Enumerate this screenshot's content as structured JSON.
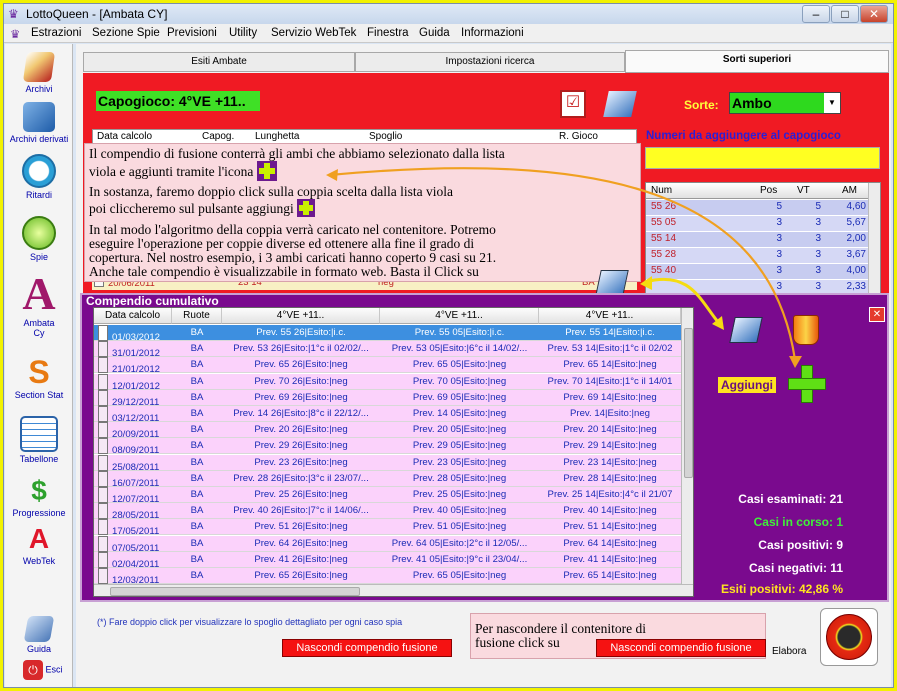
{
  "window": {
    "title": "LottoQueen - [Ambata CY]"
  },
  "menu": [
    "Estrazioni",
    "Sezione Spie",
    "Previsioni",
    "Utility",
    "Servizio WebTek",
    "Finestra",
    "Guida",
    "Informazioni"
  ],
  "sidebar": [
    "Archivi",
    "Archivi derivati",
    "Ritardi",
    "Spie",
    "Ambata Cy",
    "Section Stat",
    "Tabellone",
    "Progressione",
    "WebTek",
    "Guida",
    "Esci"
  ],
  "tabs": [
    "Esiti Ambate",
    "Impostazioni ricerca",
    "Sorti superiori"
  ],
  "top": {
    "capogioco": "Capogioco: 4°VE +11..",
    "sorte_label": "Sorte:",
    "sorte_value": "Ambo",
    "numeri_label": "Numeri da aggiungere al capogioco",
    "headers": [
      "Data calcolo",
      "Capog.",
      "Lunghetta",
      "Spoglio",
      "R. Gioco"
    ],
    "num_headers": [
      "Num",
      "Pos",
      "VT",
      "AM"
    ],
    "num_rows": [
      [
        "55 26",
        "5",
        "5",
        "4,60"
      ],
      [
        "55 05",
        "3",
        "3",
        "5,67"
      ],
      [
        "55 14",
        "3",
        "3",
        "2,00"
      ],
      [
        "55 28",
        "3",
        "3",
        "3,67"
      ],
      [
        "55 40",
        "3",
        "3",
        "4,00"
      ],
      [
        "",
        "3",
        "3",
        "2,33"
      ]
    ],
    "hidden_row": [
      "20/06/2011",
      "",
      "23 14",
      "neg",
      "BA"
    ]
  },
  "compendio": {
    "title": "Compendio cumulativo",
    "headers": [
      "Data calcolo",
      "Ruote",
      "4°VE +11..",
      "4°VE +11..",
      "4°VE +11.."
    ],
    "rows": [
      [
        "01/03/2012",
        "BA",
        "Prev. 55 26|Esito:|i.c.",
        "Prev. 55 05|Esito:|i.c.",
        "Prev. 55 14|Esito:|i.c."
      ],
      [
        "31/01/2012",
        "BA",
        "Prev. 53 26|Esito:|1°c il 02/02/...",
        "Prev. 53 05|Esito:|6°c il 14/02/...",
        "Prev. 53 14|Esito:|1°c il 02/02"
      ],
      [
        "21/01/2012",
        "BA",
        "Prev. 65 26|Esito:|neg",
        "Prev. 65 05|Esito:|neg",
        "Prev. 65 14|Esito:|neg"
      ],
      [
        "12/01/2012",
        "BA",
        "Prev. 70 26|Esito:|neg",
        "Prev. 70 05|Esito:|neg",
        "Prev. 70 14|Esito:|1°c il 14/01"
      ],
      [
        "29/12/2011",
        "BA",
        "Prev. 69 26|Esito:|neg",
        "Prev. 69 05|Esito:|neg",
        "Prev. 69 14|Esito:|neg"
      ],
      [
        "03/12/2011",
        "BA",
        "Prev. 14 26|Esito:|8°c il 22/12/...",
        "Prev. 14 05|Esito:|neg",
        "Prev. 14|Esito:|neg"
      ],
      [
        "20/09/2011",
        "BA",
        "Prev. 20 26|Esito:|neg",
        "Prev. 20 05|Esito:|neg",
        "Prev. 20 14|Esito:|neg"
      ],
      [
        "08/09/2011",
        "BA",
        "Prev. 29 26|Esito:|neg",
        "Prev. 29 05|Esito:|neg",
        "Prev. 29 14|Esito:|neg"
      ],
      [
        "25/08/2011",
        "BA",
        "Prev. 23 26|Esito:|neg",
        "Prev. 23 05|Esito:|neg",
        "Prev. 23 14|Esito:|neg"
      ],
      [
        "16/07/2011",
        "BA",
        "Prev. 28 26|Esito:|3°c il 23/07/...",
        "Prev. 28 05|Esito:|neg",
        "Prev. 28 14|Esito:|neg"
      ],
      [
        "12/07/2011",
        "BA",
        "Prev. 25 26|Esito:|neg",
        "Prev. 25 05|Esito:|neg",
        "Prev. 25 14|Esito:|4°c il 21/07"
      ],
      [
        "28/05/2011",
        "BA",
        "Prev. 40 26|Esito:|7°c il 14/06/...",
        "Prev. 40 05|Esito:|neg",
        "Prev. 40 14|Esito:|neg"
      ],
      [
        "17/05/2011",
        "BA",
        "Prev. 51 26|Esito:|neg",
        "Prev. 51 05|Esito:|neg",
        "Prev. 51 14|Esito:|neg"
      ],
      [
        "07/05/2011",
        "BA",
        "Prev. 64 26|Esito:|neg",
        "Prev. 64 05|Esito:|2°c il 12/05/...",
        "Prev. 64 14|Esito:|neg"
      ],
      [
        "02/04/2011",
        "BA",
        "Prev. 41 26|Esito:|neg",
        "Prev. 41 05|Esito:|9°c il 23/04/...",
        "Prev. 41 14|Esito:|neg"
      ],
      [
        "12/03/2011",
        "BA",
        "Prev. 65 26|Esito:|neg",
        "Prev. 65 05|Esito:|neg",
        "Prev. 65 14|Esito:|neg"
      ]
    ],
    "aggiungi": "Aggiungi",
    "stats": {
      "esaminati": "Casi esaminati: 21",
      "in_corso": "Casi in corso: 1",
      "positivi": "Casi positivi: 9",
      "negativi": "Casi negativi: 11",
      "esiti": "Esiti positivi: 42,86 %"
    }
  },
  "footer": {
    "note": "(*) Fare doppio click per visualizzare lo spoglio dettagliato per ogni caso spia",
    "hide_btn": "Nascondi compendio fusione",
    "elabora": "Elabora"
  },
  "callout1": [
    "Il compendio di fusione conterrà gli ambi che abbiamo selezionato dalla lista",
    "viola e aggiunti tramite l'icona",
    "In sostanza, faremo doppio click sulla coppia scelta dalla lista viola",
    "poi cliccheremo sul pulsante aggiungi",
    "In tal modo l'algoritmo della coppia verrà caricato nel contenitore. Potremo",
    "eseguire l'operazione per coppie diverse ed ottenere alla fine il grado di",
    "copertura. Nel nostro esempio, i 3 ambi caricati hanno coperto 9 casi su 21.",
    "Anche tale compendio è visualizzabile in formato web. Basta il Click su"
  ],
  "callout2": [
    "Per nascondere il contenitore di",
    "fusione click su"
  ]
}
